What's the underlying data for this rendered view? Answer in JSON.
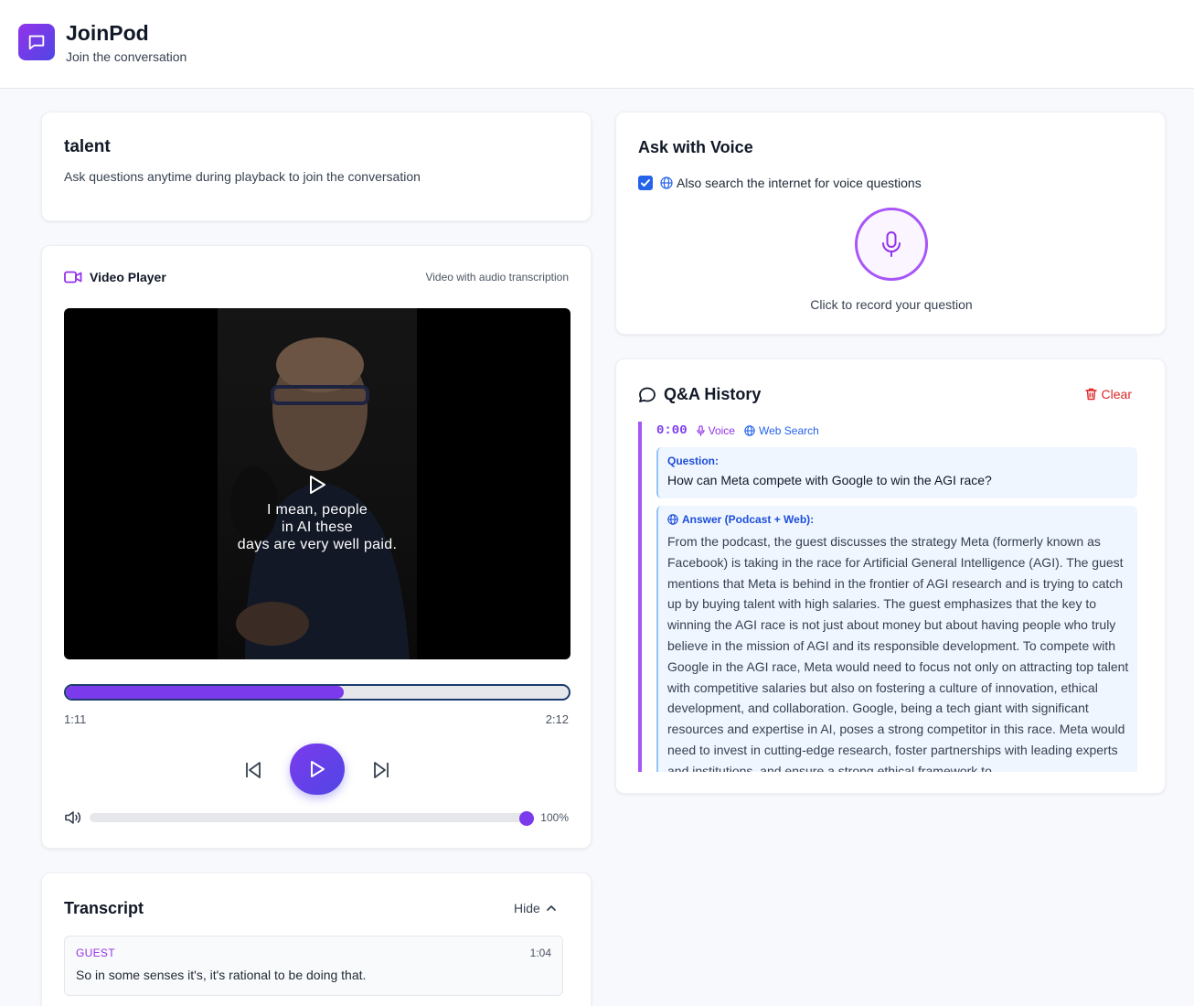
{
  "app": {
    "name": "JoinPod",
    "tagline": "Join the conversation"
  },
  "podcast": {
    "title": "talent",
    "subtitle": "Ask questions anytime during playback to join the conversation"
  },
  "video_player": {
    "title": "Video Player",
    "subtitle": "Video with audio transcription",
    "caption_lines": [
      "I mean, people",
      "in AI these",
      "days are very well paid."
    ],
    "current_time": "1:11",
    "duration": "2:12",
    "progress_fraction": 0.54,
    "volume_label": "100%",
    "volume_fraction": 1.0
  },
  "transcript": {
    "title": "Transcript",
    "toggle_label": "Hide",
    "entries": [
      {
        "speaker": "GUEST",
        "time": "1:04",
        "text": "So in some senses it's, it's rational to be doing that."
      }
    ]
  },
  "voice": {
    "title": "Ask with Voice",
    "checkbox_label": "Also search the internet for voice questions",
    "checkbox_checked": true,
    "record_label": "Click to record your question"
  },
  "qa": {
    "title": "Q&A History",
    "clear_label": "Clear",
    "items": [
      {
        "time": "0:00",
        "tags": [
          "Voice",
          "Web Search"
        ],
        "question_label": "Question:",
        "question": "How can Meta compete with Google to win the AGI race?",
        "answer_label": "Answer (Podcast + Web):",
        "answer": "From the podcast, the guest discusses the strategy Meta (formerly known as Facebook) is taking in the race for Artificial General Intelligence (AGI). The guest mentions that Meta is behind in the frontier of AGI research and is trying to catch up by buying talent with high salaries. The guest emphasizes that the key to winning the AGI race is not just about money but about having people who truly believe in the mission of AGI and its responsible development. To compete with Google in the AGI race, Meta would need to focus not only on attracting top talent with competitive salaries but also on fostering a culture of innovation, ethical development, and collaboration. Google, being a tech giant with significant resources and expertise in AI, poses a strong competitor in this race. Meta would need to invest in cutting-edge research, foster partnerships with leading experts and institutions, and ensure a strong ethical framework to"
      }
    ]
  },
  "colors": {
    "accent": "#7c3aed",
    "accent_secondary": "#4f46e5",
    "danger": "#dc2626",
    "link": "#2563eb"
  }
}
